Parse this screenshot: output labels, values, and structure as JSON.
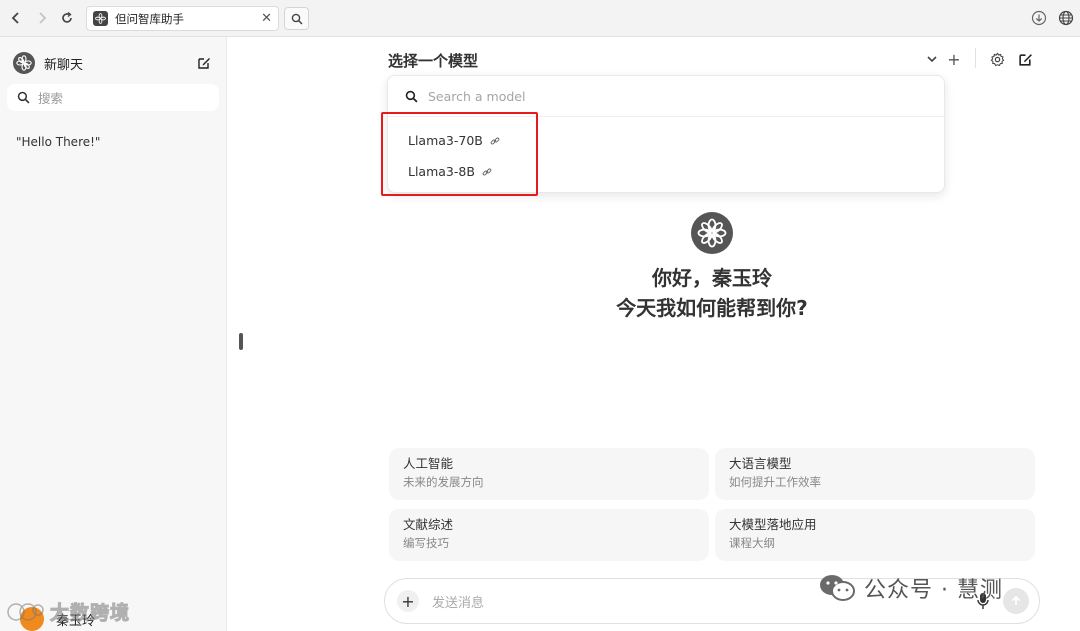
{
  "browser": {
    "tab_title": "但问智库助手",
    "tab_close": "✕"
  },
  "sidebar": {
    "new_chat_label": "新聊天",
    "search_placeholder": "搜索",
    "history": [
      "\"Hello There!\""
    ],
    "user_name": "秦玉玲"
  },
  "header": {
    "model_select_title": "选择一个模型",
    "add_symbol": "+"
  },
  "model_dropdown": {
    "search_placeholder": "Search a model",
    "models": [
      "Llama3-70B",
      "Llama3-8B"
    ]
  },
  "welcome": {
    "line1": "你好，秦玉玲",
    "line2": "今天我如何能帮到你?"
  },
  "suggestions": [
    {
      "title": "人工智能",
      "subtitle": "未来的发展方向"
    },
    {
      "title": "大语言模型",
      "subtitle": "如何提升工作效率"
    },
    {
      "title": "文献综述",
      "subtitle": "编写技巧"
    },
    {
      "title": "大模型落地应用",
      "subtitle": "课程大纲"
    }
  ],
  "composer": {
    "placeholder": "发送消息",
    "plus": "+"
  },
  "watermarks": {
    "left": "大数跨境",
    "right": "公众号 · 慧测"
  },
  "colors": {
    "highlight_border": "#e8191c",
    "avatar_orange": "#f08a1c",
    "logo_dark": "#555555"
  },
  "icons": [
    "back-icon",
    "forward-icon",
    "reload-icon",
    "search-icon",
    "close-icon",
    "download-icon",
    "globe-icon",
    "edit-icon",
    "chevron-down-icon",
    "plus-icon",
    "settings-icon",
    "link-icon",
    "mic-icon",
    "send-arrow-icon",
    "flower-logo-icon"
  ]
}
